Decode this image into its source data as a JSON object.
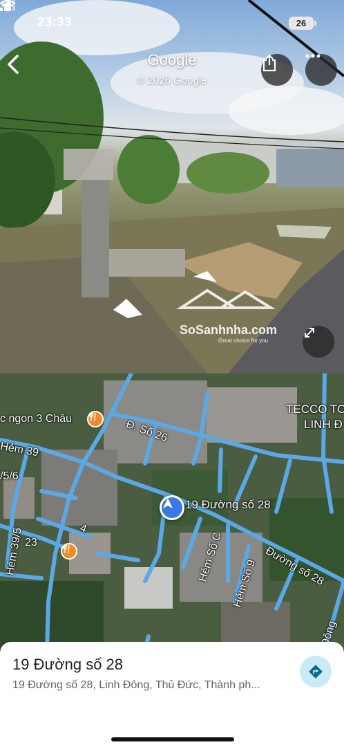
{
  "status_bar": {
    "time": "23:33",
    "battery": "26",
    "icons": [
      "location-arrow-icon",
      "cellular-signal-icon",
      "wifi-icon",
      "battery-icon"
    ]
  },
  "street_view": {
    "title": "Google",
    "copyright": "© 2026 Google",
    "watermark_text": "SoSanhnha.com",
    "watermark_tagline": "Great choice for you",
    "buttons": {
      "back_icon": "chevron-left-icon",
      "share_icon": "share-icon",
      "more_icon": "more-horizontal-icon",
      "expand_icon": "expand-icon"
    }
  },
  "map": {
    "labels": {
      "restaurant": "c ngon 3 Châu",
      "d_so_26": "Đ. Số 26",
      "hem_39": "Hẻm 39",
      "num_5_6": "/5/6",
      "hem_39_5": "Hẻm 39/5",
      "num_23": "23",
      "num_4": "4",
      "selected_address": "19 Đường số 28",
      "hem_so_c": "Hẻm Số C",
      "hem_so_9": "Hẻm Số 9",
      "duong_so_28": "Đường số 28",
      "tecco": "TECCO TO",
      "linh_d": "LINH Đ",
      "dong": "Đông"
    },
    "colors": {
      "road": "#5aa9e6",
      "poi": "#f08a24",
      "marker": "#3b78e7"
    }
  },
  "place": {
    "title": "19 Đường số 28",
    "address": "19 Đường số 28, Linh Đông, Thủ Đức, Thành ph...",
    "directions_icon": "directions-icon"
  }
}
